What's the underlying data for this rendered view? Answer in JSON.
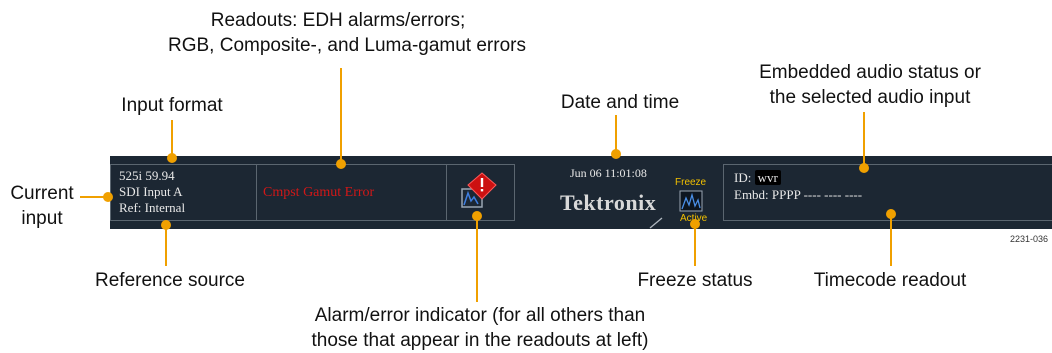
{
  "callouts": {
    "readouts_line1": "Readouts: EDH alarms/errors;",
    "readouts_line2": "RGB, Composite-, and Luma-gamut errors",
    "input_format": "Input format",
    "date_time": "Date and time",
    "embedded_audio_line1": "Embedded audio status or",
    "embedded_audio_line2": "the selected audio input",
    "current_input_line1": "Current",
    "current_input_line2": "input",
    "reference_source": "Reference source",
    "freeze_status": "Freeze status",
    "timecode_readout": "Timecode readout",
    "alarm_line1": "Alarm/error indicator (for all others than",
    "alarm_line2": "those that appear in the readouts at left)"
  },
  "status_bar": {
    "input_format": "525i 59.94",
    "current_input": "SDI Input A",
    "reference": "Ref: Internal",
    "gamut_error": "Cmpst Gamut Error",
    "datetime": "Jun 06 11:01:08",
    "brand": "Tektronix",
    "freeze_top": "Freeze",
    "freeze_bottom": "Active",
    "id_label": "ID:",
    "id_value": "wvr",
    "embd_status": "Embd: PPPP ---- ---- ----"
  },
  "figure_number": "2231-036",
  "colors": {
    "bar_background": "#1c2733",
    "callout_line": "#f0a000",
    "error_text": "#d01818",
    "alarm_icon": "#cc1111",
    "freeze_text": "#f2c000"
  }
}
